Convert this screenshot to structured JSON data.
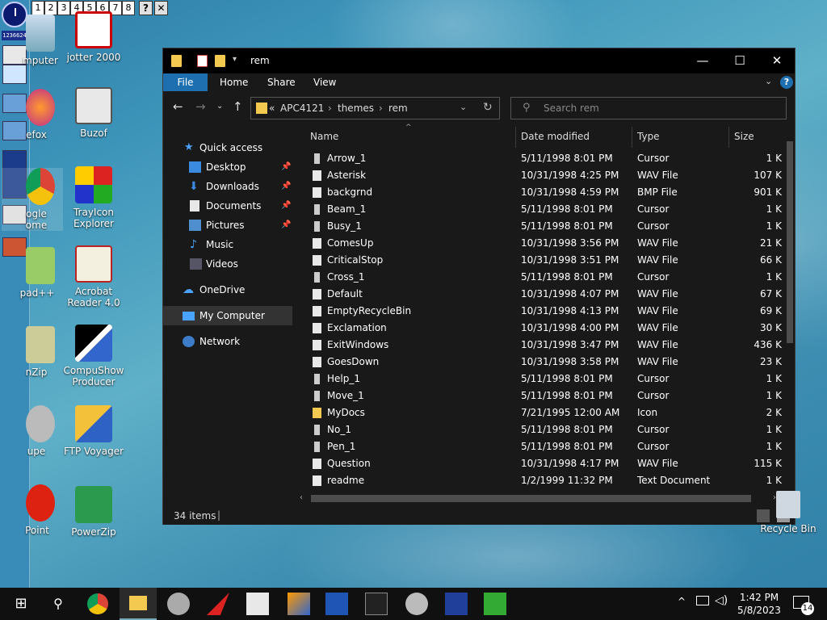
{
  "colors": {
    "accent": "#1e6fb0",
    "window_bg": "#191919",
    "titlebar_bg": "#000000",
    "selected_nav": "#333333"
  },
  "workspaces": [
    "1",
    "2",
    "3",
    "4",
    "5",
    "6",
    "7",
    "8"
  ],
  "workspace_help": "?",
  "workspace_close": "✕",
  "counter_text": "1236624",
  "desktop_icons": [
    {
      "label": "mputer",
      "icon": "computer-icon"
    },
    {
      "label": "jotter 2000",
      "icon": "jotter-icon"
    },
    {
      "label": "efox",
      "icon": "firefox-icon"
    },
    {
      "label": "Buzof",
      "icon": "buzof-icon"
    },
    {
      "label": "ogle\nome",
      "icon": "chrome-icon"
    },
    {
      "label": "TrayIcon\nExplorer",
      "icon": "trayicon-explorer-icon"
    },
    {
      "label": "pad++",
      "icon": "notepad-plus-icon"
    },
    {
      "label": "Acrobat\nReader 4.0",
      "icon": "acrobat-reader-icon"
    },
    {
      "label": "nZip",
      "icon": "winzip-icon"
    },
    {
      "label": "CompuShow\nProducer",
      "icon": "compushow-icon"
    },
    {
      "label": "upe",
      "icon": "magnifier-icon"
    },
    {
      "label": "FTP Voyager",
      "icon": "ftp-voyager-icon"
    },
    {
      "label": "Point",
      "icon": "point-icon"
    },
    {
      "label": "PowerZip",
      "icon": "powerzip-icon"
    }
  ],
  "window": {
    "title": "rem",
    "controls": {
      "minimize": "—",
      "maximize": "☐",
      "close": "✕"
    },
    "ribbon_tabs": [
      "File",
      "Home",
      "Share",
      "View"
    ],
    "help": "?",
    "address": {
      "prefix": "«",
      "crumbs": [
        "APC4121",
        "themes",
        "rem"
      ],
      "sep": "›"
    },
    "search_placeholder": "Search rem",
    "nav": [
      {
        "label": "Quick access",
        "pinned": false
      },
      {
        "label": "Desktop",
        "pinned": true
      },
      {
        "label": "Downloads",
        "pinned": true
      },
      {
        "label": "Documents",
        "pinned": true
      },
      {
        "label": "Pictures",
        "pinned": true
      },
      {
        "label": "Music",
        "pinned": false
      },
      {
        "label": "Videos",
        "pinned": false
      },
      {
        "label": "OneDrive",
        "pinned": false
      },
      {
        "label": "My Computer",
        "pinned": false,
        "selected": true
      },
      {
        "label": "Network",
        "pinned": false
      }
    ],
    "columns": {
      "name": "Name",
      "date": "Date modified",
      "type": "Type",
      "size": "Size"
    },
    "files": [
      {
        "name": "Arrow_1",
        "date": "5/11/1998 8:01 PM",
        "type": "Cursor",
        "size": "1 K"
      },
      {
        "name": "Asterisk",
        "date": "10/31/1998 4:25 PM",
        "type": "WAV File",
        "size": "107 K"
      },
      {
        "name": "backgrnd",
        "date": "10/31/1998 4:59 PM",
        "type": "BMP File",
        "size": "901 K"
      },
      {
        "name": "Beam_1",
        "date": "5/11/1998 8:01 PM",
        "type": "Cursor",
        "size": "1 K"
      },
      {
        "name": "Busy_1",
        "date": "5/11/1998 8:01 PM",
        "type": "Cursor",
        "size": "1 K"
      },
      {
        "name": "ComesUp",
        "date": "10/31/1998 3:56 PM",
        "type": "WAV File",
        "size": "21 K"
      },
      {
        "name": "CriticalStop",
        "date": "10/31/1998 3:51 PM",
        "type": "WAV File",
        "size": "66 K"
      },
      {
        "name": "Cross_1",
        "date": "5/11/1998 8:01 PM",
        "type": "Cursor",
        "size": "1 K"
      },
      {
        "name": "Default",
        "date": "10/31/1998 4:07 PM",
        "type": "WAV File",
        "size": "67 K"
      },
      {
        "name": "EmptyRecycleBin",
        "date": "10/31/1998 4:13 PM",
        "type": "WAV File",
        "size": "69 K"
      },
      {
        "name": "Exclamation",
        "date": "10/31/1998 4:00 PM",
        "type": "WAV File",
        "size": "30 K"
      },
      {
        "name": "ExitWindows",
        "date": "10/31/1998 3:47 PM",
        "type": "WAV File",
        "size": "436 K"
      },
      {
        "name": "GoesDown",
        "date": "10/31/1998 3:58 PM",
        "type": "WAV File",
        "size": "23 K"
      },
      {
        "name": "Help_1",
        "date": "5/11/1998 8:01 PM",
        "type": "Cursor",
        "size": "1 K"
      },
      {
        "name": "Move_1",
        "date": "5/11/1998 8:01 PM",
        "type": "Cursor",
        "size": "1 K"
      },
      {
        "name": "MyDocs",
        "date": "7/21/1995 12:00 AM",
        "type": "Icon",
        "size": "2 K"
      },
      {
        "name": "No_1",
        "date": "5/11/1998 8:01 PM",
        "type": "Cursor",
        "size": "1 K"
      },
      {
        "name": "Pen_1",
        "date": "5/11/1998 8:01 PM",
        "type": "Cursor",
        "size": "1 K"
      },
      {
        "name": "Question",
        "date": "10/31/1998 4:17 PM",
        "type": "WAV File",
        "size": "115 K"
      },
      {
        "name": "readme",
        "date": "1/2/1999 11:32 PM",
        "type": "Text Document",
        "size": "1 K"
      }
    ],
    "status": "34 items"
  },
  "recycle_bin": "Recycle Bin",
  "taskbar": {
    "icons": [
      "windows-start-icon",
      "search-icon",
      "chrome-icon",
      "file-explorer-icon",
      "magnifier-icon",
      "arrow-app-icon",
      "buzof-icon",
      "media-icon",
      "ftp-icon",
      "terminal-icon",
      "tool-icon",
      "star-app-icon",
      "recycle-app-icon"
    ],
    "time": "1:42 PM",
    "date": "5/8/2023",
    "notifications": "14"
  }
}
